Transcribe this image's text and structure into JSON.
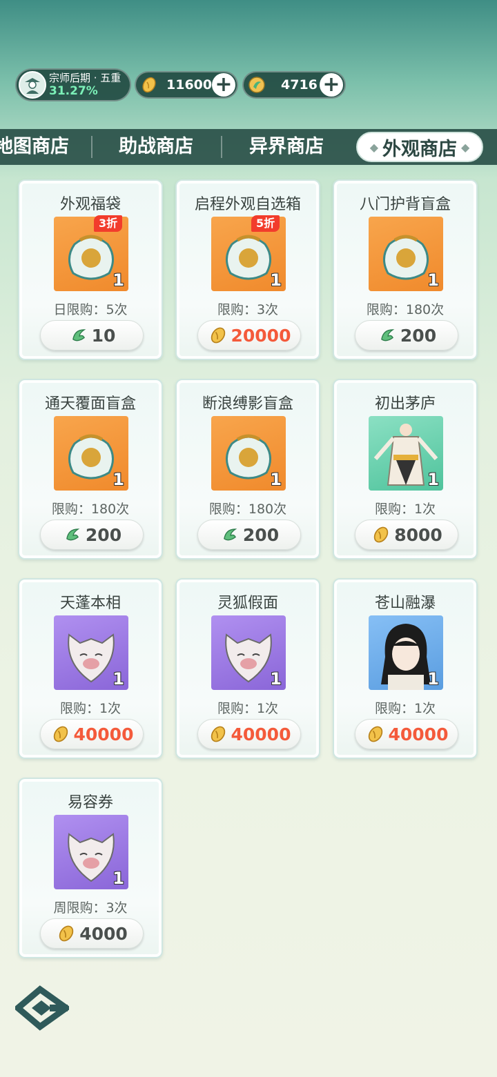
{
  "status": {
    "rank_title": "宗师后期 · 五重",
    "rank_progress": "31.27%",
    "currency_gold": "11600",
    "currency_jade": "4716"
  },
  "tabs": {
    "items": [
      "地图商店",
      "助战商店",
      "异界商店"
    ],
    "active": "外观商店"
  },
  "items": [
    {
      "name": "外观福袋",
      "badge": "3折",
      "qty": "1",
      "limit": "日限购：5次",
      "price": "10",
      "currency": "jade",
      "thumb": "orange"
    },
    {
      "name": "启程外观自选箱",
      "badge": "5折",
      "qty": "1",
      "limit": "限购：3次",
      "price": "20000",
      "currency": "gold",
      "thumb": "orange"
    },
    {
      "name": "八门护背盲盒",
      "badge": "",
      "qty": "1",
      "limit": "限购：180次",
      "price": "200",
      "currency": "jade",
      "thumb": "orange"
    },
    {
      "name": "通天覆面盲盒",
      "badge": "",
      "qty": "1",
      "limit": "限购：180次",
      "price": "200",
      "currency": "jade",
      "thumb": "orange"
    },
    {
      "name": "断浪缚影盲盒",
      "badge": "",
      "qty": "1",
      "limit": "限购：180次",
      "price": "200",
      "currency": "jade",
      "thumb": "orange"
    },
    {
      "name": "初出茅庐",
      "badge": "",
      "qty": "1",
      "limit": "限购：1次",
      "price": "8000",
      "currency": "gold",
      "thumb": "teal"
    },
    {
      "name": "天蓬本相",
      "badge": "",
      "qty": "1",
      "limit": "限购：1次",
      "price": "40000",
      "currency": "gold",
      "thumb": "purple"
    },
    {
      "name": "灵狐假面",
      "badge": "",
      "qty": "1",
      "limit": "限购：1次",
      "price": "40000",
      "currency": "gold",
      "thumb": "purple"
    },
    {
      "name": "苍山融瀑",
      "badge": "",
      "qty": "1",
      "limit": "限购：1次",
      "price": "40000",
      "currency": "gold",
      "thumb": "blue"
    },
    {
      "name": "易容券",
      "badge": "",
      "qty": "1",
      "limit": "周限购：3次",
      "price": "4000",
      "currency": "gold",
      "thumb": "purple"
    }
  ],
  "colors": {
    "price_red": "#f45a3b",
    "badge_red": "#f23c2c",
    "tab_bar": "#284e46"
  },
  "icons": [
    "rank-avatar-icon",
    "gold-coin-icon",
    "jade-icon",
    "plus-icon",
    "menu-logo-icon"
  ]
}
